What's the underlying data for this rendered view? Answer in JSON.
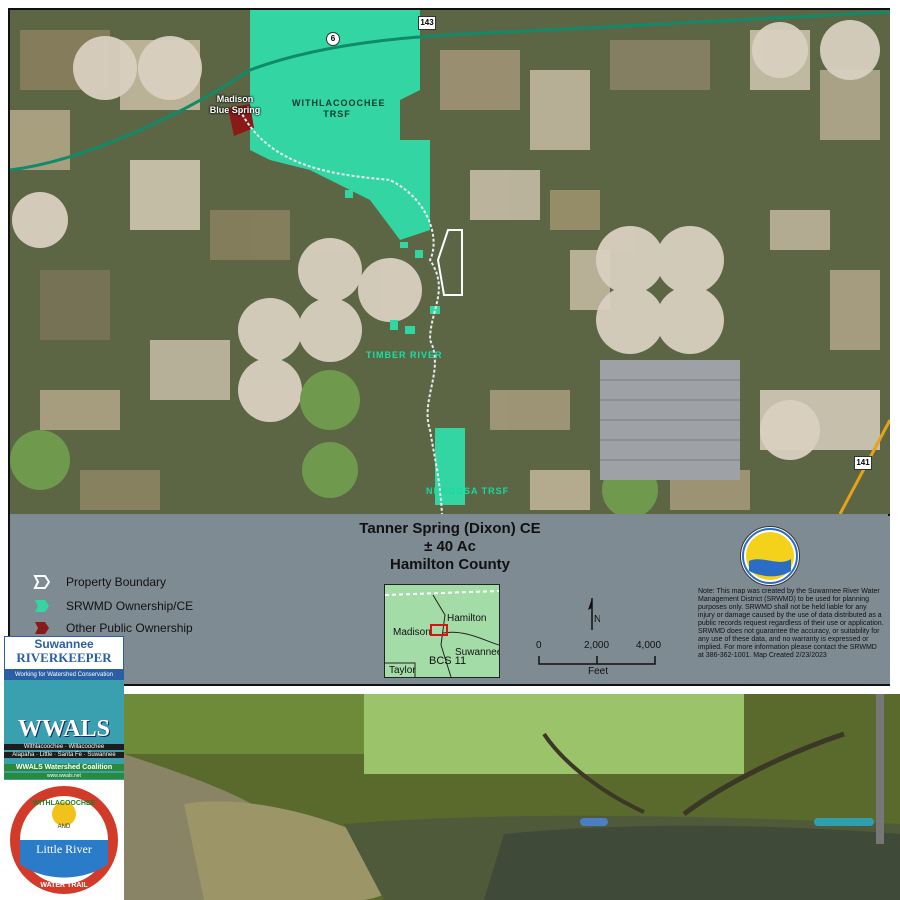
{
  "map": {
    "labels": {
      "withlacoochee": "WITHLACOOCHEE TRSF",
      "timber_river": "TIMBER RIVER",
      "nekoosa": "NEKOOSA TRSF",
      "madison_blue": "Madison Blue Spring"
    },
    "shields": {
      "route6": "6",
      "route143": "143",
      "route141": "141"
    }
  },
  "panel": {
    "title_line1": "Tanner Spring (Dixon) CE",
    "title_line2": "± 40 Ac",
    "title_line3": "Hamilton County",
    "legend": [
      {
        "label": "Property Boundary",
        "color": "#ffffff",
        "icon": "property-boundary-symbol"
      },
      {
        "label": "SRWMD Ownership/CE",
        "color": "#33d6a3",
        "icon": "srwmd-symbol"
      },
      {
        "label": "Other Public Ownership",
        "color": "#8a1a1a",
        "icon": "public-symbol"
      }
    ],
    "inset": {
      "hamilton": "Hamilton",
      "madison": "Madison",
      "suwannee": "Suwannee",
      "bcs": "BCS 11",
      "taylor": "Taylor"
    },
    "scale": {
      "tick0": "0",
      "tick1": "2,000",
      "tick2": "4,000",
      "unit": "Feet"
    },
    "note": "Note: This map was created by the Suwannee River Water Management District (SRWMD) to be used for planning purposes only. SRWMD shall not be held liable for any injury or damage caused by the use of data distributed as a public records request regardless of their use or application. SRWMD does not guarantee the accuracy, or suitability for any use of these data, and no warranty is expressed or implied. For more information please contact the SRWMD at 386-362-1001. Map Created 2/23/2023"
  },
  "logos": {
    "riverkeeper_top": "Suwannee",
    "riverkeeper_bottom": "RIVERKEEPER",
    "riverkeeper_tagline": "Working for Watershed Conservation",
    "wwals": "WWALS",
    "wwals_rivers1": "Withlacoochee · Willacoochee",
    "wwals_rivers2": "Alapaha · Little · Santa Fe · Suwannee",
    "wwals_coalition": "WWALS Watershed Coalition",
    "wwals_url": "www.wwals.net",
    "trail_top": "WITHLACOOCHEE",
    "trail_and": "AND",
    "trail_mid": "Little River",
    "trail_bottom": "WATER TRAIL"
  }
}
